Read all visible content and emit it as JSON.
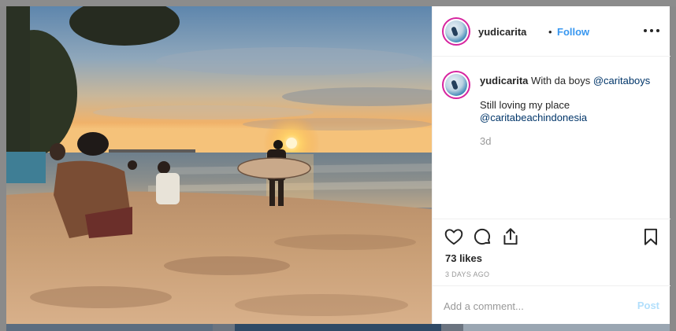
{
  "post": {
    "username": "yudicarita",
    "follow_label": "Follow",
    "separator": "•",
    "caption": {
      "text_before_mention": "With da boys",
      "mention1": "@caritaboys",
      "line2": "Still loving my place",
      "mention2": "@caritabeachindonesia",
      "time": "3d"
    },
    "likes": "73 likes",
    "posted_ago": "3 DAYS AGO",
    "comment": {
      "placeholder": "Add a comment...",
      "value": "",
      "post_label": "Post"
    }
  },
  "icons": {
    "header_more": "more-options-icon",
    "like": "heart-icon",
    "comment": "comment-bubble-icon",
    "share": "share-icon",
    "save": "bookmark-icon"
  },
  "colors": {
    "follow": "#3897f0",
    "mention": "#003569",
    "post_disabled": "#b2dffc",
    "avatar_ring": "#d6249f"
  }
}
